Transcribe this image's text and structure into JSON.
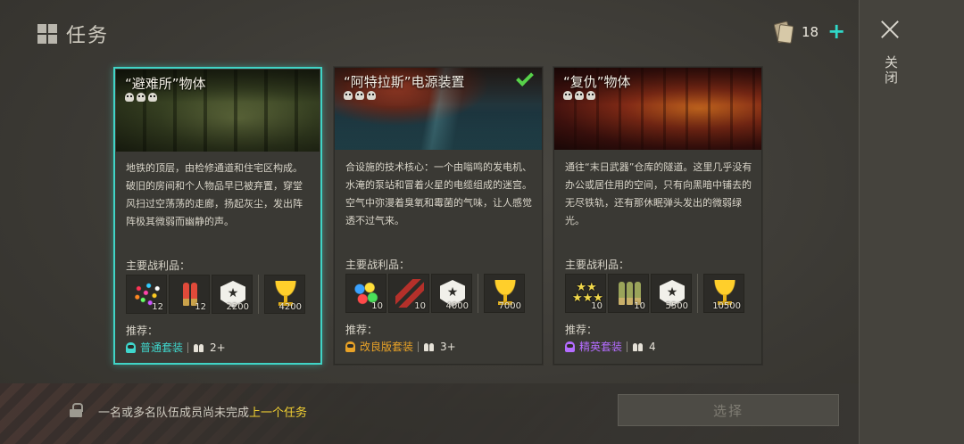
{
  "header": {
    "title": "任务"
  },
  "currency": {
    "value": "18"
  },
  "close": {
    "label": "关闭"
  },
  "cards": [
    {
      "title": "“避难所”物体",
      "selected": true,
      "completed": false,
      "description": "地铁的顶层，由检修通道和住宅区构成。破旧的房间和个人物品早已被弃置，穿堂风扫过空荡荡的走廊，扬起灰尘，发出阵阵极其微弱而幽静的声。",
      "loot_label": "主要战利品：",
      "loot": [
        {
          "icon": "confetti-icon",
          "qty": "12"
        },
        {
          "icon": "shotgun-shells-icon",
          "qty": "12"
        },
        {
          "icon": "badge-icon",
          "qty": "2200"
        },
        {
          "icon": "trophy-icon",
          "qty": "4200"
        }
      ],
      "recommend_label": "推荐：",
      "suit": "普通套装",
      "suit_color": "#3fd6cc",
      "party": "2+"
    },
    {
      "title": "“阿特拉斯”电源装置",
      "selected": false,
      "completed": true,
      "description": "合设施的技术核心：一个由嗡鸣的发电机、水淹的泵站和冒着火星的电缆组成的迷宫。空气中弥漫着臭氧和霉菌的气味，让人感觉透不过气来。",
      "loot_label": "主要战利品：",
      "loot": [
        {
          "icon": "colored-balls-icon",
          "qty": "10"
        },
        {
          "icon": "dynamite-icon",
          "qty": "10"
        },
        {
          "icon": "badge-icon",
          "qty": "4000"
        },
        {
          "icon": "trophy-icon",
          "qty": "7000"
        }
      ],
      "recommend_label": "推荐：",
      "suit": "改良版套装",
      "suit_color": "#e8a227",
      "party": "3+"
    },
    {
      "title": "“复仇”物体",
      "selected": false,
      "completed": false,
      "description": "通往“末日武器”仓库的隧道。这里几乎没有办公或居住用的空间，只有向黑暗中铺去的无尽铁轨，还有那休眠弹头发出的微弱绿光。",
      "loot_label": "主要战利品：",
      "loot": [
        {
          "icon": "stars-icon",
          "qty": "10"
        },
        {
          "icon": "rifle-rounds-icon",
          "qty": "10"
        },
        {
          "icon": "badge-icon",
          "qty": "5500"
        },
        {
          "icon": "trophy-icon",
          "qty": "10500"
        }
      ],
      "recommend_label": "推荐：",
      "suit": "精英套装",
      "suit_color": "#b46cff",
      "party": "4"
    }
  ],
  "footer": {
    "notice_prefix": "一名或多名队伍成员尚未完成",
    "notice_highlight": "上一个任务",
    "select_label": "选择"
  }
}
